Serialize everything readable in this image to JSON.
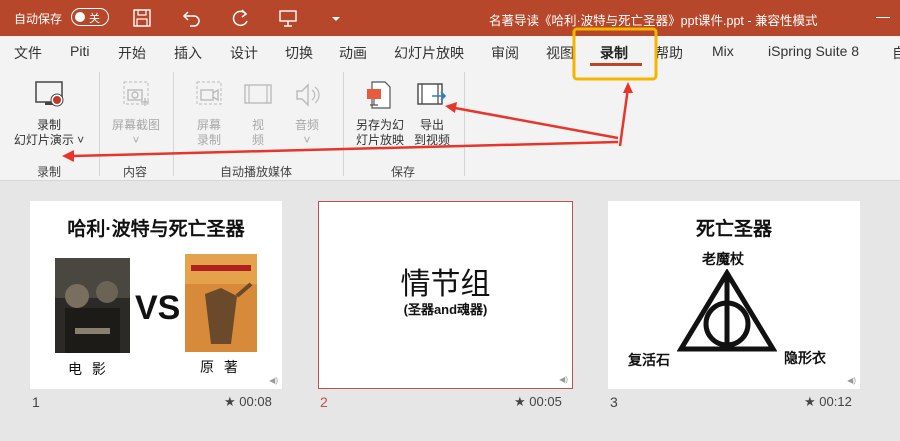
{
  "titlebar": {
    "autosave_label": "自动保存",
    "autosave_state": "关",
    "doc_title": "名著导读《哈利·波特与死亡圣器》ppt课件.ppt  -  兼容性模式"
  },
  "tabs": [
    "文件",
    "Piti",
    "开始",
    "插入",
    "设计",
    "切换",
    "动画",
    "幻灯片放映",
    "审阅",
    "视图",
    "录制",
    "帮助",
    "Mix",
    "iSpring Suite 8",
    "自"
  ],
  "active_tab": "录制",
  "ribbon": {
    "record_btn": {
      "line1": "录制",
      "line2": "幻灯片演示 ˅"
    },
    "screenshot_btn": {
      "line1": "屏幕截图",
      "line2": "˅"
    },
    "screen_record_btn": {
      "line1": "屏幕",
      "line2": "录制"
    },
    "video_btn": {
      "line1": "视",
      "line2": "频"
    },
    "audio_btn": {
      "line1": "音频",
      "line2": "˅"
    },
    "save_as_show_btn": {
      "line1": "另存为幻",
      "line2": "灯片放映"
    },
    "export_video_btn": {
      "line1": "导出",
      "line2": "到视频"
    },
    "groups": {
      "record": "录制",
      "content": "内容",
      "media": "自动播放媒体",
      "save": "保存"
    }
  },
  "slides": [
    {
      "num": "1",
      "time": "00:08",
      "title": "哈利·波特与死亡圣器",
      "vs": "VS",
      "left_caption": "电 影",
      "right_caption": "原 著"
    },
    {
      "num": "2",
      "time": "00:05",
      "title": "情节组",
      "subtitle": "(圣器and魂器)"
    },
    {
      "num": "3",
      "time": "00:12",
      "title": "死亡圣器",
      "top_label": "老魔杖",
      "left_label": "复活石",
      "right_label": "隐形衣"
    }
  ],
  "colors": {
    "brand": "#b7472a",
    "highlight": "#f5b400",
    "arrow": "#e8352b"
  }
}
